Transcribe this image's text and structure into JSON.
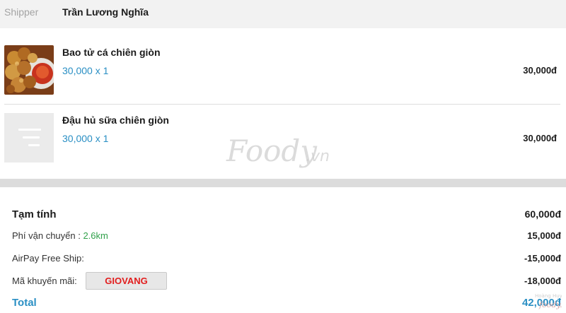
{
  "shipper": {
    "label": "Shipper",
    "name": "Trần Lương Nghĩa"
  },
  "items": [
    {
      "name": "Bao tử cá chiên giòn",
      "qty_text": "30,000 x 1",
      "price": "30,000đ",
      "thumbnail": "food-photo"
    },
    {
      "name": "Đậu hủ sữa chiên giòn",
      "qty_text": "30,000 x 1",
      "price": "30,000đ",
      "thumbnail": "placeholder-image-icon"
    }
  ],
  "watermark": "Foody.vn",
  "summary": {
    "subtotal": {
      "label": "Tạm tính",
      "value": "60,000đ"
    },
    "shipping": {
      "label": "Phí vận chuyển : ",
      "distance": "2.6km",
      "value": "15,000đ"
    },
    "airpay": {
      "label": "AirPay Free Ship:",
      "value": "-15,000đ"
    },
    "promo": {
      "label": "Mã khuyến mãi:",
      "code": "GIOVANG",
      "value": "-18,000đ"
    },
    "total": {
      "label": "Total",
      "value": "42,000đ"
    }
  },
  "colors": {
    "accent_blue": "#2a8fc4",
    "promo_red": "#e21d1d",
    "distance_green": "#31a14b"
  }
}
